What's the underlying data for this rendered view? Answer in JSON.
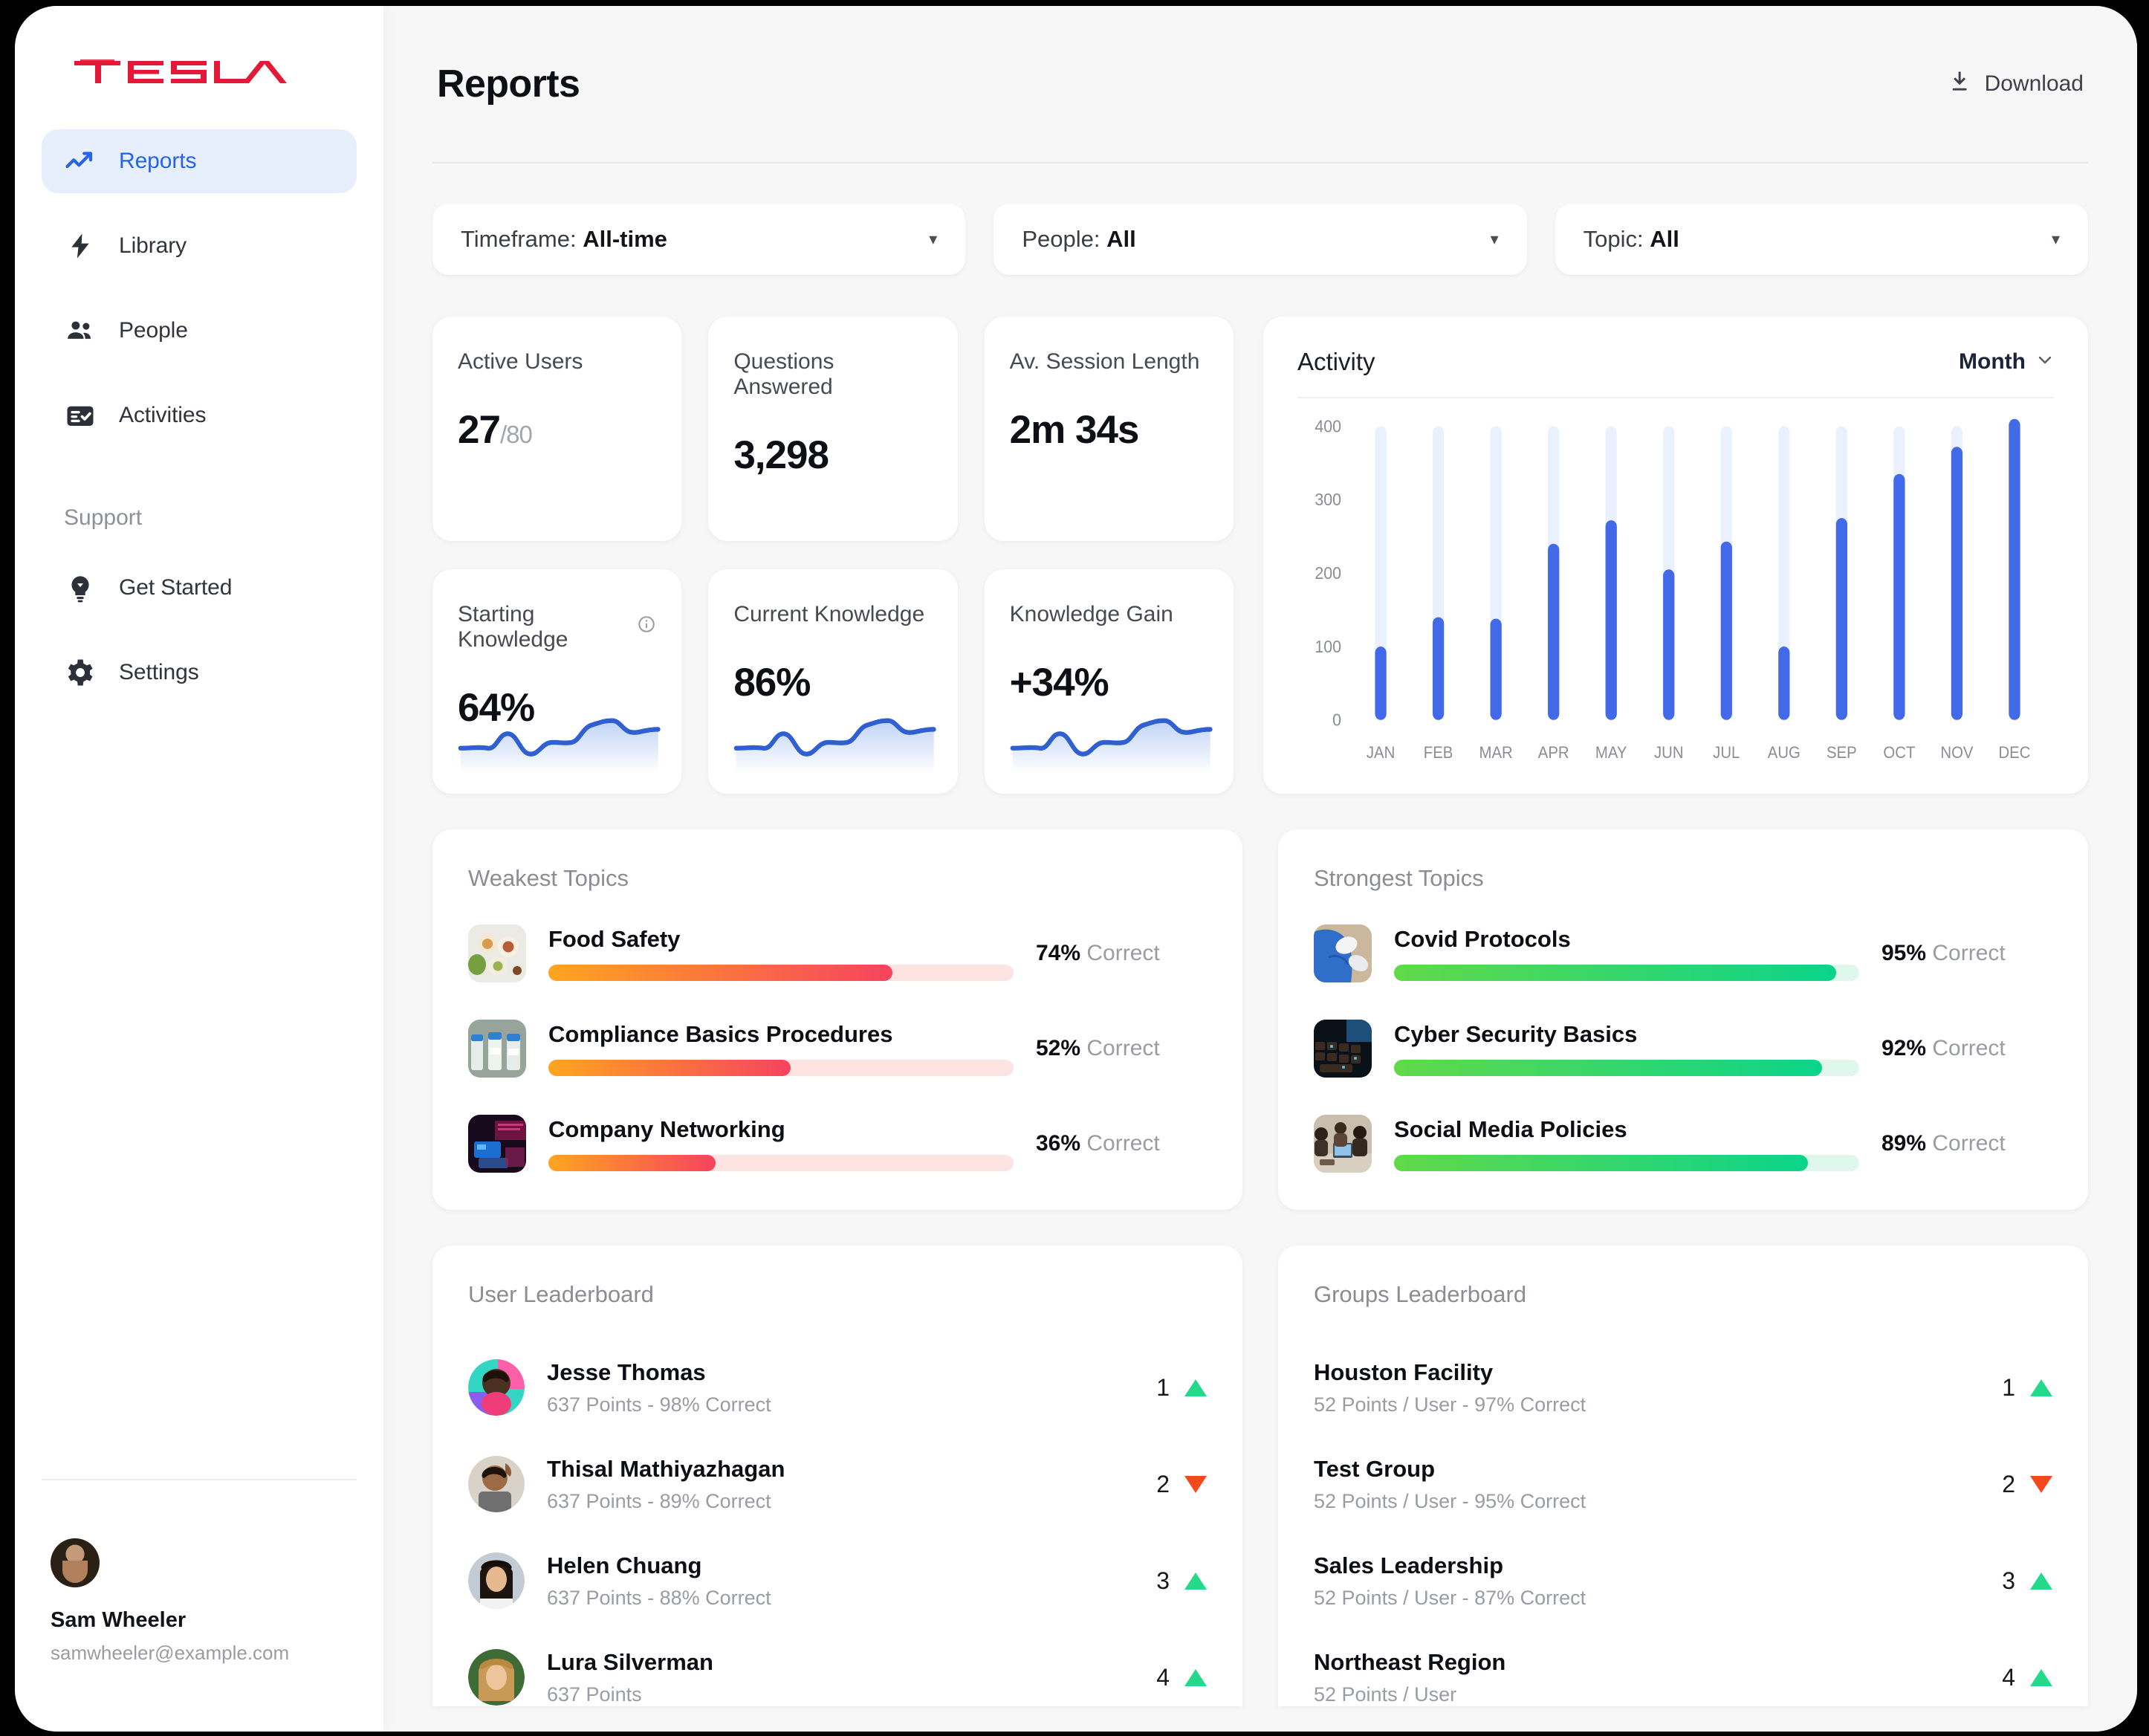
{
  "brand": {
    "name": "TESLA",
    "logo_color": "#e31937"
  },
  "sidebar": {
    "nav": [
      {
        "label": "Reports",
        "icon": "trending-up-icon",
        "active": true
      },
      {
        "label": "Library",
        "icon": "bolt-icon",
        "active": false
      },
      {
        "label": "People",
        "icon": "people-icon",
        "active": false
      },
      {
        "label": "Activities",
        "icon": "list-check-icon",
        "active": false
      }
    ],
    "support_heading": "Support",
    "support": [
      {
        "label": "Get Started",
        "icon": "lightbulb-icon"
      },
      {
        "label": "Settings",
        "icon": "gear-icon"
      }
    ],
    "user": {
      "name": "Sam Wheeler",
      "email": "samwheeler@example.com",
      "avatar": "user-avatar"
    }
  },
  "header": {
    "title": "Reports",
    "download_label": "Download",
    "download_icon": "download-icon"
  },
  "filters": [
    {
      "name": "timeframe",
      "label": "Timeframe:",
      "value": "All-time"
    },
    {
      "name": "people",
      "label": "People:",
      "value": "All"
    },
    {
      "name": "topic",
      "label": "Topic:",
      "value": "All"
    }
  ],
  "stats": [
    {
      "label": "Active Users",
      "value": "27",
      "suffix": "/80",
      "info": false,
      "spark": false
    },
    {
      "label": "Questions Answered",
      "value": "3,298",
      "suffix": "",
      "info": false,
      "spark": false
    },
    {
      "label": "Av. Session Length",
      "value": "2m 34s",
      "suffix": "",
      "info": false,
      "spark": false
    },
    {
      "label": "Starting Knowledge",
      "value": "64%",
      "suffix": "",
      "info": true,
      "spark": true
    },
    {
      "label": "Current Knowledge",
      "value": "86%",
      "suffix": "",
      "info": false,
      "spark": true
    },
    {
      "label": "Knowledge Gain",
      "value": "+34%",
      "suffix": "",
      "info": false,
      "spark": true
    }
  ],
  "activity": {
    "title": "Activity",
    "range_label": "Month",
    "range_icon": "chevron-down-icon"
  },
  "chart_data": {
    "type": "bar",
    "title": "Activity",
    "categories": [
      "JAN",
      "FEB",
      "MAR",
      "APR",
      "MAY",
      "JUN",
      "JUL",
      "AUG",
      "SEP",
      "OCT",
      "NOV",
      "DEC"
    ],
    "values": [
      100,
      140,
      138,
      240,
      272,
      205,
      243,
      100,
      275,
      335,
      372,
      410
    ],
    "ylabel": "",
    "xlabel": "",
    "ytick_labels": [
      "400",
      "300",
      "200",
      "100",
      "0"
    ],
    "ytick_values": [
      400,
      300,
      200,
      100,
      0
    ],
    "ylim": [
      0,
      420
    ],
    "track_max": 400,
    "grid": false,
    "legend": false,
    "bar_color": "#4169e8",
    "track_color": "#eaf0fe"
  },
  "weakest": {
    "title": "Weakest Topics",
    "correct_suffix": "Correct",
    "items": [
      {
        "name": "Food Safety",
        "pct": 74,
        "pct_label": "74%",
        "thumb": "food-plates-thumb"
      },
      {
        "name": "Compliance Basics Procedures",
        "pct": 52,
        "pct_label": "52%",
        "thumb": "covid-vials-thumb"
      },
      {
        "name": "Company Networking",
        "pct": 36,
        "pct_label": "36%",
        "thumb": "neon-network-thumb"
      }
    ]
  },
  "strongest": {
    "title": "Strongest Topics",
    "correct_suffix": "Correct",
    "items": [
      {
        "name": "Covid Protocols",
        "pct": 95,
        "pct_label": "95%",
        "thumb": "medical-gloves-thumb"
      },
      {
        "name": "Cyber Security Basics",
        "pct": 92,
        "pct_label": "92%",
        "thumb": "keyboard-thumb"
      },
      {
        "name": "Social Media Policies",
        "pct": 89,
        "pct_label": "89%",
        "thumb": "meeting-thumb"
      }
    ]
  },
  "user_leaderboard": {
    "title": "User Leaderboard",
    "rows": [
      {
        "name": "Jesse Thomas",
        "sub": "637 Points - 98% Correct",
        "rank": "1",
        "trend": "up",
        "avatar": "avatar-jesse"
      },
      {
        "name": "Thisal Mathiyazhagan",
        "sub": "637 Points - 89% Correct",
        "rank": "2",
        "trend": "down",
        "avatar": "avatar-thisal"
      },
      {
        "name": "Helen Chuang",
        "sub": "637 Points - 88% Correct",
        "rank": "3",
        "trend": "up",
        "avatar": "avatar-helen"
      },
      {
        "name": "Lura Silverman",
        "sub": "637 Points",
        "rank": "4",
        "trend": "up",
        "avatar": "avatar-lura"
      }
    ]
  },
  "groups_leaderboard": {
    "title": "Groups Leaderboard",
    "rows": [
      {
        "name": "Houston Facility",
        "sub": "52 Points / User - 97% Correct",
        "rank": "1",
        "trend": "up"
      },
      {
        "name": "Test Group",
        "sub": "52 Points / User - 95% Correct",
        "rank": "2",
        "trend": "down"
      },
      {
        "name": "Sales Leadership",
        "sub": "52 Points / User -  87% Correct",
        "rank": "3",
        "trend": "up"
      },
      {
        "name": "Northeast Region",
        "sub": "52 Points / User",
        "rank": "4",
        "trend": "up"
      }
    ]
  },
  "colors": {
    "accent_blue": "#2563eb",
    "bar_blue": "#4169e8",
    "weak_gradient_start": "#ffa51f",
    "weak_gradient_end": "#f6435e",
    "strong_gradient_start": "#62d94a",
    "strong_gradient_end": "#0ad48a",
    "trend_up": "#25d98a",
    "trend_down": "#f4491d",
    "brand_red": "#e31937"
  }
}
